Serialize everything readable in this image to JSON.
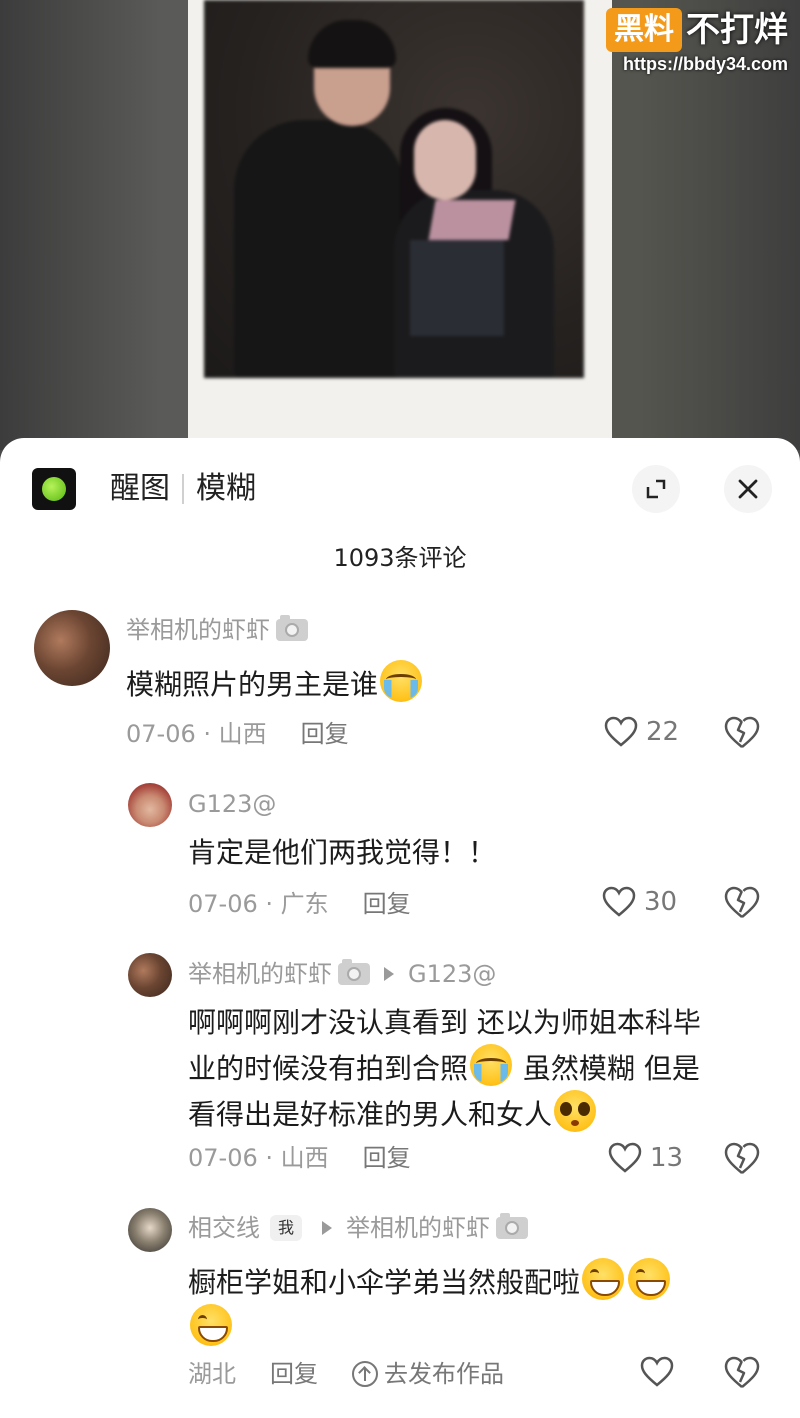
{
  "watermark": {
    "badge": "黑料",
    "text": "不打烊",
    "url": "https://bbdy34.com"
  },
  "header": {
    "title_left": "醒图",
    "title_right": "模糊",
    "expand_icon": "expand-icon",
    "close_icon": "close-icon"
  },
  "comment_count": "1093条评论",
  "comments": [
    {
      "username": "举相机的虾虾",
      "text": "模糊照片的男主是谁",
      "date_location": "07-06 · 山西",
      "reply_label": "回复",
      "likes": "22"
    },
    {
      "username": "G123@",
      "text": "肯定是他们两我觉得！！",
      "date_location": "07-06 · 广东",
      "reply_label": "回复",
      "likes": "30"
    },
    {
      "username": "举相机的虾虾",
      "reply_to": "G123@",
      "text_line1": "啊啊啊刚才没认真看到 还以为师姐本科毕",
      "text_line2a": "业的时候没有拍到合照",
      "text_line2b": " 虽然模糊 但是",
      "text_line3": "看得出是好标准的男人和女人",
      "date_location": "07-06 · 山西",
      "reply_label": "回复",
      "likes": "13"
    },
    {
      "username": "相交线",
      "me_badge": "我",
      "reply_to": "举相机的虾虾",
      "text": "橱柜学姐和小伞学弟当然般配啦",
      "location": "湖北",
      "reply_label": "回复",
      "publish_label": "去发布作品",
      "likes": ""
    }
  ],
  "colors": {
    "watermark_badge": "#f39a1b",
    "sheet_bg": "#ffffff",
    "meta_text": "#9a9a9a"
  }
}
